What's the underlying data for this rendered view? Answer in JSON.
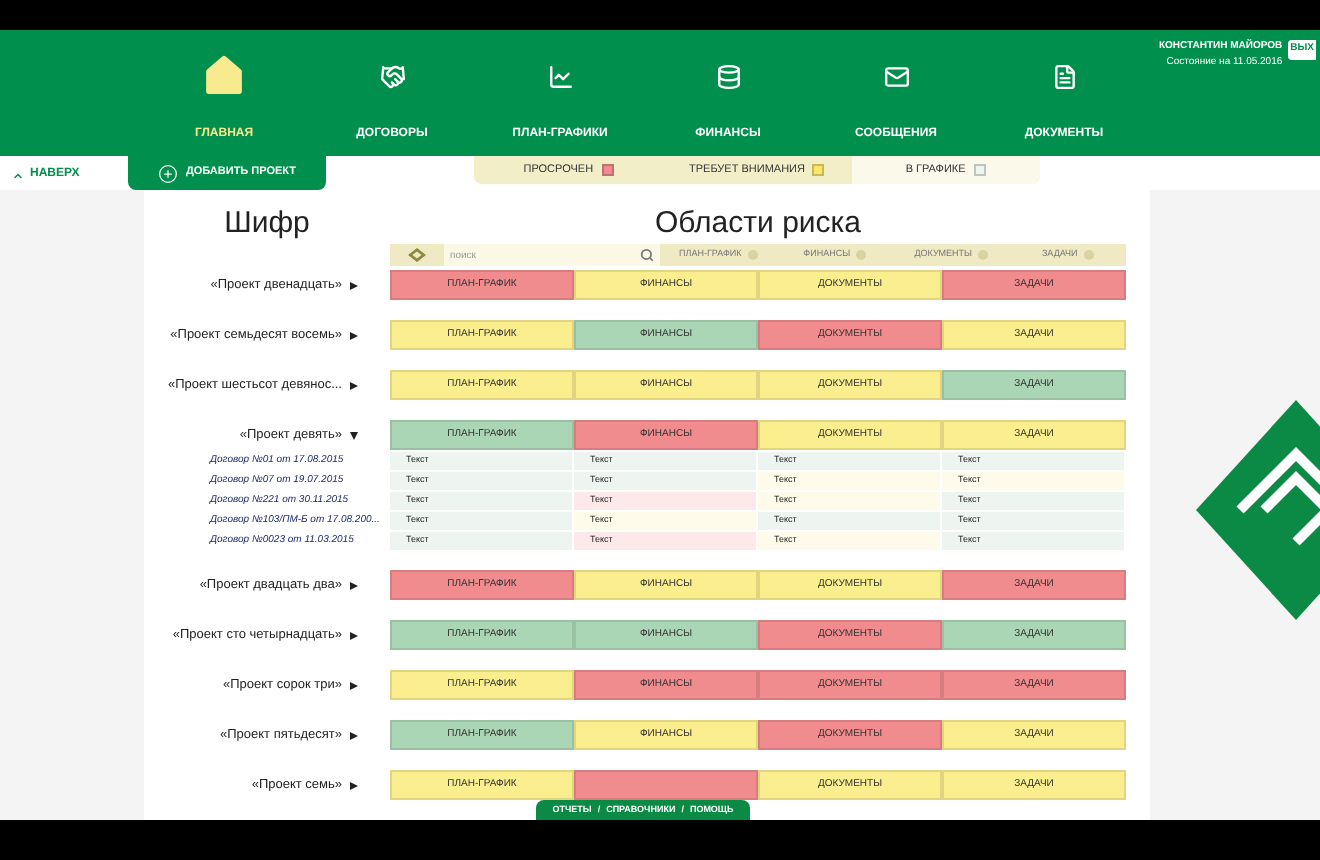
{
  "header": {
    "nav": [
      {
        "label": "ГЛАВНАЯ",
        "selected": true
      },
      {
        "label": "ДОГОВОРЫ",
        "selected": false
      },
      {
        "label": "ПЛАН-ГРАФИКИ",
        "selected": false
      },
      {
        "label": "ФИНАНСЫ",
        "selected": false
      },
      {
        "label": "СООБЩЕНИЯ",
        "selected": false
      },
      {
        "label": "ДОКУМЕНТЫ",
        "selected": false
      }
    ],
    "user": {
      "name": "КОНСТАНТИН МАЙОРОВ",
      "status": "Состояние на 11.05.2016",
      "exit_button": "ВЫХ"
    }
  },
  "toolbar": {
    "back_link": "НАВЕРХ",
    "add_project": "ДОБАВИТЬ ПРОЕКТ",
    "legend": [
      {
        "label": "ПРОСРОЧЕН",
        "color": "#f08c8e"
      },
      {
        "label": "ТРЕБУЕТ ВНИМАНИЯ",
        "color": "#fbe86a"
      },
      {
        "label": "В ГРАФИКЕ",
        "color": "#eef6ee"
      }
    ]
  },
  "titles": {
    "code": "Шифр",
    "risk_areas": "Области риска"
  },
  "search": {
    "placeholder": "поиск",
    "columns": [
      "ПЛАН-ГРАФИК",
      "ФИНАНСЫ",
      "ДОКУМЕНТЫ",
      "ЗАДАЧИ"
    ]
  },
  "projects": [
    {
      "name": "«Проект двенадцать»",
      "expanded": false,
      "cells": [
        {
          "label": "ПЛАН-ГРАФИК",
          "color": "#f08c8e"
        },
        {
          "label": "ФИНАНСЫ",
          "color": "#fbee8e"
        },
        {
          "label": "ДОКУМЕНТЫ",
          "color": "#fbee8e"
        },
        {
          "label": "ЗАДАЧИ",
          "color": "#f08c8e"
        }
      ]
    },
    {
      "name": "«Проект семьдесят восемь»",
      "expanded": false,
      "cells": [
        {
          "label": "ПЛАН-ГРАФИК",
          "color": "#fbee8e"
        },
        {
          "label": "ФИНАНСЫ",
          "color": "#abd6b6"
        },
        {
          "label": "ДОКУМЕНТЫ",
          "color": "#f08c8e"
        },
        {
          "label": "ЗАДАЧИ",
          "color": "#fbee8e"
        }
      ]
    },
    {
      "name": "«Проект шестьсот девянос...",
      "expanded": false,
      "cells": [
        {
          "label": "ПЛАН-ГРАФИК",
          "color": "#fbee8e"
        },
        {
          "label": "ФИНАНСЫ",
          "color": "#fbee8e"
        },
        {
          "label": "ДОКУМЕНТЫ",
          "color": "#fbee8e"
        },
        {
          "label": "ЗАДАЧИ",
          "color": "#abd6b6"
        }
      ]
    },
    {
      "name": "«Проект девять»",
      "expanded": true,
      "cells": [
        {
          "label": "ПЛАН-ГРАФИК",
          "color": "#abd6b6"
        },
        {
          "label": "ФИНАНСЫ",
          "color": "#f08c8e"
        },
        {
          "label": "ДОКУМЕНТЫ",
          "color": "#fbee8e"
        },
        {
          "label": "ЗАДАЧИ",
          "color": "#fbee8e"
        }
      ],
      "contracts": [
        {
          "name": "Договор №01 от 17.08.2015",
          "cells": [
            {
              "text": "Текст",
              "color": "#eef5f0"
            },
            {
              "text": "Текст",
              "color": "#eef5f0"
            },
            {
              "text": "Текст",
              "color": "#eef5f0"
            },
            {
              "text": "Текст",
              "color": "#eef5f0"
            }
          ]
        },
        {
          "name": "Договор №07 от 19.07.2015",
          "cells": [
            {
              "text": "Текст",
              "color": "#eef5f0"
            },
            {
              "text": "Текст",
              "color": "#eef5f0"
            },
            {
              "text": "Текст",
              "color": "#fffbea"
            },
            {
              "text": "Текст",
              "color": "#fffbea"
            }
          ]
        },
        {
          "name": "Договор №221 от 30.11.2015",
          "cells": [
            {
              "text": "Текст",
              "color": "#eef5f0"
            },
            {
              "text": "Текст",
              "color": "#fde8ea"
            },
            {
              "text": "Текст",
              "color": "#fffbea"
            },
            {
              "text": "Текст",
              "color": "#eef5f0"
            }
          ]
        },
        {
          "name": "Договор №103/ПМ-Б от 17.08.200...",
          "cells": [
            {
              "text": "Текст",
              "color": "#eef5f0"
            },
            {
              "text": "Текст",
              "color": "#fffbea"
            },
            {
              "text": "Текст",
              "color": "#eef5f0"
            },
            {
              "text": "Текст",
              "color": "#eef5f0"
            }
          ]
        },
        {
          "name": "Договор №0023 от 11.03.2015",
          "cells": [
            {
              "text": "Текст",
              "color": "#eef5f0"
            },
            {
              "text": "Текст",
              "color": "#fde8ea"
            },
            {
              "text": "Текст",
              "color": "#fffbea"
            },
            {
              "text": "Текст",
              "color": "#eef5f0"
            }
          ]
        }
      ]
    },
    {
      "name": "«Проект двадцать два»",
      "expanded": false,
      "cells": [
        {
          "label": "ПЛАН-ГРАФИК",
          "color": "#f08c8e"
        },
        {
          "label": "ФИНАНСЫ",
          "color": "#fbee8e"
        },
        {
          "label": "ДОКУМЕНТЫ",
          "color": "#fbee8e"
        },
        {
          "label": "ЗАДАЧИ",
          "color": "#f08c8e"
        }
      ]
    },
    {
      "name": "«Проект сто четырнадцать»",
      "expanded": false,
      "cells": [
        {
          "label": "ПЛАН-ГРАФИК",
          "color": "#abd6b6"
        },
        {
          "label": "ФИНАНСЫ",
          "color": "#abd6b6"
        },
        {
          "label": "ДОКУМЕНТЫ",
          "color": "#f08c8e"
        },
        {
          "label": "ЗАДАЧИ",
          "color": "#abd6b6"
        }
      ]
    },
    {
      "name": "«Проект сорок три»",
      "expanded": false,
      "cells": [
        {
          "label": "ПЛАН-ГРАФИК",
          "color": "#fbee8e"
        },
        {
          "label": "ФИНАНСЫ",
          "color": "#f08c8e"
        },
        {
          "label": "ДОКУМЕНТЫ",
          "color": "#f08c8e"
        },
        {
          "label": "ЗАДАЧИ",
          "color": "#f08c8e"
        }
      ]
    },
    {
      "name": "«Проект пятьдесят»",
      "expanded": false,
      "cells": [
        {
          "label": "ПЛАН-ГРАФИК",
          "color": "#abd6b6"
        },
        {
          "label": "ФИНАНСЫ",
          "color": "#fbee8e"
        },
        {
          "label": "ДОКУМЕНТЫ",
          "color": "#f08c8e"
        },
        {
          "label": "ЗАДАЧИ",
          "color": "#fbee8e"
        }
      ]
    },
    {
      "name": "«Проект семь»",
      "expanded": false,
      "cells": [
        {
          "label": "ПЛАН-ГРАФИК",
          "color": "#fbee8e"
        },
        {
          "color": "#f08c8e"
        },
        {
          "label": "ДОКУМЕНТЫ",
          "color": "#fbee8e"
        },
        {
          "label": "ЗАДАЧИ",
          "color": "#fbee8e"
        }
      ]
    }
  ],
  "footer": {
    "links": [
      "ОТЧЕТЫ",
      "СПРАВОЧНИКИ",
      "ПОМОЩЬ"
    ],
    "separators": [
      "/",
      "/"
    ]
  }
}
